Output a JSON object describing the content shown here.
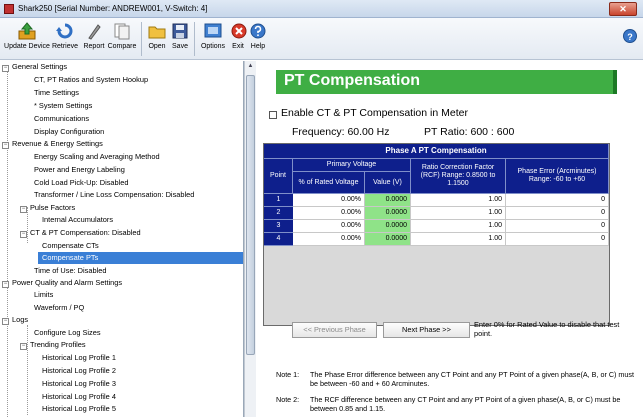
{
  "window": {
    "title": "Shark250 [Serial Number: ANDREW001, V-Switch: 4]",
    "close_glyph": "✕"
  },
  "toolbar": {
    "update_device": "Update Device",
    "retrieve": "Retrieve",
    "report": "Report",
    "compare": "Compare",
    "open": "Open",
    "save": "Save",
    "options": "Options",
    "exit": "Exit",
    "help": "Help",
    "help_corner": "?"
  },
  "tree": {
    "general": "General Settings",
    "ct_pt": "CT, PT Ratios and System Hookup",
    "time": "Time Settings",
    "system": "* System Settings",
    "comms": "Communications",
    "display": "Display Configuration",
    "revenue": "Revenue & Energy Settings",
    "energy_scaling": "Energy Scaling and Averaging Method",
    "power_energy": "Power and Energy Labeling",
    "cold_load": "Cold Load Pick-Up: Disabled",
    "transformer": "Transformer / Line Loss Compensation: Disabled",
    "pulse": "Pulse Factors",
    "internal_acc": "Internal Accumulators",
    "ct_pt_comp": "CT & PT Compensation: Disabled",
    "comp_cts": "Compensate CTs",
    "comp_pts": "Compensate PTs",
    "tou": "Time of Use: Disabled",
    "pq_alarm": "Power Quality and Alarm Settings",
    "limits": "Limits",
    "waveform": "Waveform / PQ",
    "logs": "Logs",
    "log_sizes": "Configure Log Sizes",
    "trending": "Trending Profiles",
    "hist1": "Historical Log Profile 1",
    "hist2": "Historical Log Profile 2",
    "hist3": "Historical Log Profile 3",
    "hist4": "Historical Log Profile 4",
    "hist5": "Historical Log Profile 5"
  },
  "main": {
    "title": "PT Compensation",
    "enable_label": "Enable CT & PT Compensation in Meter",
    "frequency": "Frequency:  60.00 Hz",
    "pt_ratio": "PT Ratio:  600 : 600",
    "table": {
      "caption": "Phase A PT Compensation",
      "col_point": "Point",
      "col_primary_voltage": "Primary Voltage",
      "col_pct_rated": "% of Rated Voltage",
      "col_value": "Value (V)",
      "col_rcf": "Ratio Correction Factor (RCF) Range: 0.8500 to 1.1500",
      "col_phase_error": "Phase Error (Arcminutes) Range: -60 to +60",
      "rows": [
        {
          "point": "1",
          "pct": "0.00%",
          "value": "0.0000",
          "rcf": "1.00",
          "phase_error": "0"
        },
        {
          "point": "2",
          "pct": "0.00%",
          "value": "0.0000",
          "rcf": "1.00",
          "phase_error": "0"
        },
        {
          "point": "3",
          "pct": "0.00%",
          "value": "0.0000",
          "rcf": "1.00",
          "phase_error": "0"
        },
        {
          "point": "4",
          "pct": "0.00%",
          "value": "0.0000",
          "rcf": "1.00",
          "phase_error": "0"
        }
      ]
    },
    "prev_phase": "<< Previous Phase",
    "next_phase": "Next Phase >>",
    "hint": "Enter 0% for Rated Value to disable that test point.",
    "note1_label": "Note 1:",
    "note1": "The Phase Error difference between any CT Point and any PT Point of a given phase(A, B, or C) must be between -60 and + 60 Arcminutes.",
    "note2_label": "Note 2:",
    "note2": "The RCF difference between any CT Point and any PT Point of a given phase(A, B, or C) must be between 0.85 and 1.15."
  }
}
